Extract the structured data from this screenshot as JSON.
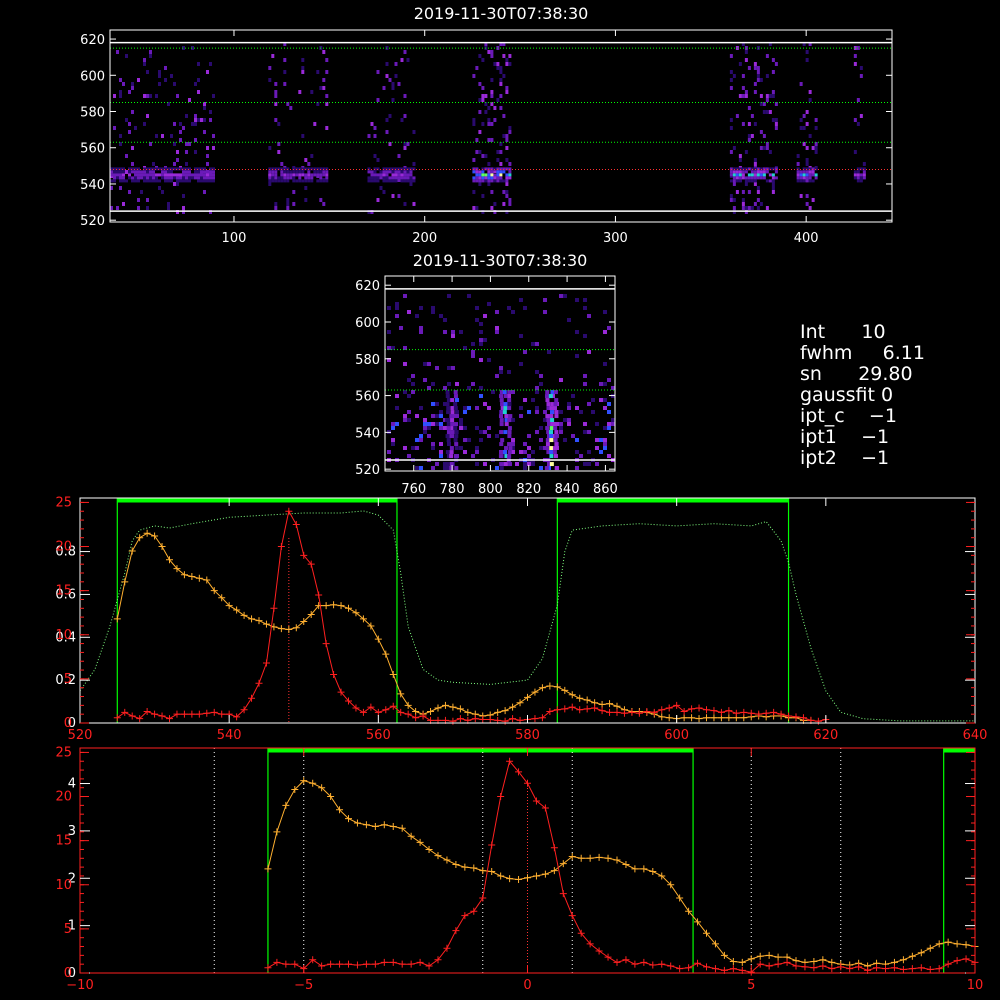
{
  "colors": {
    "background": "#000000",
    "white": "#ffffff",
    "red": "#ff2020",
    "orange": "#ffb030",
    "green": "#00ff00",
    "lightgreen": "#80ff80",
    "darkred": "#ff3030"
  },
  "info": [
    {
      "key": "Int",
      "value": "10"
    },
    {
      "key": "fwhm",
      "value": "6.11"
    },
    {
      "key": "sn",
      "value": "29.80"
    },
    {
      "key": "gaussfit",
      "value": "0"
    },
    {
      "key": "ipt_c",
      "value": "−1"
    },
    {
      "key": "ipt1",
      "value": "−1"
    },
    {
      "key": "ipt2",
      "value": "−1"
    }
  ],
  "chart_data": [
    {
      "type": "heatmap",
      "title": "2019-11-30T07:38:30",
      "xlim": [
        35,
        445
      ],
      "ylim": [
        519,
        625
      ],
      "xticks": [
        100,
        200,
        300,
        400
      ],
      "yticks": [
        520,
        540,
        560,
        580,
        600,
        620
      ],
      "white_lines": [
        525,
        618
      ],
      "green_dotted_lines": [
        563,
        585,
        615
      ],
      "red_dotted_lines": [
        548
      ],
      "bright_row": 545,
      "bands": [
        [
          35,
          90,
          0.5
        ],
        [
          118,
          148,
          0.5
        ],
        [
          170,
          195,
          0.5
        ],
        [
          225,
          245,
          1.0
        ],
        [
          360,
          385,
          0.8
        ],
        [
          395,
          405,
          0.7
        ],
        [
          425,
          430,
          0.5
        ]
      ]
    },
    {
      "type": "heatmap",
      "title": "2019-11-30T07:38:30",
      "xlim": [
        745,
        865
      ],
      "ylim": [
        519,
        625
      ],
      "xticks": [
        760,
        780,
        800,
        820,
        840,
        860
      ],
      "yticks": [
        520,
        540,
        560,
        580,
        600,
        620
      ],
      "white_lines": [
        525,
        618
      ],
      "green_dotted_lines": [
        563,
        585
      ],
      "streaks": [
        [
          780,
          0.5
        ],
        [
          808,
          0.8
        ],
        [
          832,
          1.0
        ]
      ]
    },
    {
      "type": "line",
      "xlim": [
        520,
        640
      ],
      "xticks": [
        520,
        540,
        560,
        580,
        600,
        620,
        640
      ],
      "left_ylim": [
        0,
        1.05
      ],
      "left_yticks": [
        0,
        0.2,
        0.4,
        0.6,
        0.8
      ],
      "red_ylim": [
        0,
        25.5
      ],
      "red_yticks": [
        0,
        5,
        10,
        15,
        20,
        25
      ],
      "green_boxes": [
        [
          525,
          562.5
        ],
        [
          584,
          615
        ]
      ],
      "red_dotted_x": [
        548
      ],
      "series": [
        {
          "axis": "left",
          "color": "lightgreen",
          "style": "dotted",
          "x": [
            520,
            522,
            524,
            526,
            527,
            528,
            530,
            532,
            535,
            540,
            545,
            550,
            555,
            558,
            560,
            562,
            563,
            564,
            566,
            568,
            570,
            575,
            580,
            582,
            584,
            585,
            586,
            590,
            595,
            600,
            605,
            610,
            612,
            614,
            615,
            616,
            618,
            620,
            622,
            625,
            630,
            635,
            640
          ],
          "y": [
            0.15,
            0.25,
            0.45,
            0.7,
            0.85,
            0.9,
            0.92,
            0.91,
            0.93,
            0.96,
            0.97,
            0.98,
            0.98,
            0.99,
            0.97,
            0.9,
            0.7,
            0.45,
            0.25,
            0.2,
            0.19,
            0.18,
            0.2,
            0.3,
            0.55,
            0.8,
            0.9,
            0.92,
            0.93,
            0.92,
            0.93,
            0.92,
            0.94,
            0.85,
            0.75,
            0.6,
            0.35,
            0.15,
            0.05,
            0.02,
            0.01,
            0.01,
            0.01
          ]
        },
        {
          "axis": "red",
          "color": "orange",
          "style": "solid",
          "x": [
            525,
            526,
            527,
            528,
            529,
            530,
            531,
            532,
            533,
            534,
            535,
            536,
            537,
            538,
            539,
            540,
            541,
            542,
            543,
            544,
            545,
            546,
            547,
            548,
            549,
            550,
            551,
            552,
            553,
            554,
            555,
            556,
            557,
            558,
            559,
            560,
            561,
            562,
            563,
            564,
            565,
            566,
            567,
            568,
            569,
            570,
            571,
            572,
            573,
            574,
            575,
            576,
            577,
            578,
            579,
            580,
            581,
            582,
            583,
            584,
            585,
            586,
            587,
            588,
            589,
            590,
            591,
            592,
            593,
            594,
            595,
            596,
            597,
            598,
            599,
            600,
            601,
            602,
            603,
            604,
            605,
            606,
            607,
            608,
            609,
            610,
            611,
            612,
            613,
            614,
            615,
            616,
            617,
            618
          ],
          "y": [
            11.8,
            16,
            19.5,
            21,
            21.5,
            21.2,
            20,
            18.5,
            17.5,
            16.8,
            16.6,
            16.4,
            16.2,
            15,
            14.2,
            13.3,
            12.8,
            12.2,
            11.8,
            11.6,
            11.2,
            10.9,
            10.7,
            10.6,
            10.8,
            11.5,
            12.3,
            13.3,
            13.3,
            13.4,
            13.3,
            13,
            12.5,
            11.8,
            11,
            9.5,
            7.8,
            5.5,
            3.3,
            2,
            1.3,
            1,
            1.3,
            1.7,
            2,
            1.8,
            1.6,
            1.2,
            1,
            0.8,
            0.9,
            1.2,
            1.4,
            1.8,
            2.3,
            2.9,
            3.5,
            4,
            4.2,
            4.1,
            3.7,
            3.2,
            2.8,
            2.6,
            2.3,
            2.1,
            2.2,
            1.9,
            1.5,
            1.3,
            1.3,
            1.2,
            1,
            0.7,
            0.6,
            0.5,
            0.6,
            0.6,
            0.5,
            0.6,
            0.6,
            0.6,
            0.6,
            0.6,
            0.6,
            0.7,
            0.8,
            0.7,
            0.8,
            0.8,
            0.6,
            0.6,
            0.3,
            0.3
          ]
        },
        {
          "axis": "red",
          "color": "red",
          "style": "solid",
          "x": [
            525,
            526,
            527,
            528,
            529,
            530,
            531,
            532,
            533,
            534,
            535,
            536,
            537,
            538,
            539,
            540,
            541,
            542,
            543,
            544,
            545,
            546,
            547,
            548,
            549,
            550,
            551,
            552,
            553,
            554,
            555,
            556,
            557,
            558,
            559,
            560,
            561,
            562,
            563,
            564,
            565,
            566,
            567,
            568,
            569,
            570,
            571,
            572,
            573,
            574,
            575,
            576,
            577,
            578,
            579,
            580,
            581,
            582,
            583,
            584,
            585,
            586,
            587,
            588,
            589,
            590,
            591,
            592,
            593,
            594,
            595,
            596,
            597,
            598,
            599,
            600,
            601,
            602,
            603,
            604,
            605,
            606,
            607,
            608,
            609,
            610,
            611,
            612,
            613,
            614,
            615,
            616,
            617,
            618,
            619,
            620
          ],
          "y": [
            0.6,
            1.2,
            0.8,
            0.5,
            1.3,
            1,
            0.8,
            0.5,
            1,
            1,
            1,
            1,
            1.1,
            1.2,
            1,
            1,
            0.7,
            1.5,
            2.8,
            4.5,
            6.8,
            13,
            20,
            24,
            22.5,
            19,
            18,
            14.5,
            9,
            5.5,
            3.5,
            2.5,
            1.7,
            1.2,
            1.8,
            1.2,
            1.5,
            1.9,
            1.2,
            1,
            0.6,
            0.8,
            0.3,
            0.3,
            0.3,
            0.2,
            0.5,
            0.3,
            0.5,
            0.4,
            0.4,
            0.3,
            0.2,
            0.5,
            0.3,
            0.4,
            0.5,
            0.6,
            1.3,
            1.5,
            1.6,
            1.8,
            1.5,
            1.6,
            1.7,
            1.4,
            1.2,
            1.2,
            1.1,
            1.2,
            1.1,
            1.3,
            1.2,
            1.5,
            1.7,
            2,
            1.3,
            1.6,
            1.7,
            1.5,
            1.4,
            1.2,
            1.4,
            1.1,
            1.2,
            1.1,
            1,
            1.1,
            1.2,
            1,
            0.8,
            0.7,
            0.6,
            0.3,
            0.2,
            0.4
          ]
        }
      ]
    },
    {
      "type": "line",
      "xlim": [
        -10,
        10
      ],
      "xticks": [
        -10,
        -5,
        0,
        5,
        10
      ],
      "left_ylim": [
        0,
        4.75
      ],
      "left_yticks": [
        0,
        1,
        2,
        3,
        4
      ],
      "red_ylim": [
        0,
        25.5
      ],
      "red_yticks": [
        0,
        5,
        10,
        15,
        20,
        25
      ],
      "green_boxes": [
        [
          -5.8,
          3.7
        ],
        [
          9.3,
          10.5
        ]
      ],
      "white_dotted_x": [
        -7,
        -5,
        -1,
        1,
        5,
        7
      ],
      "red_dotted_x": [
        0
      ],
      "series": [
        {
          "axis": "red",
          "color": "orange",
          "style": "solid",
          "x": [
            -5.8,
            -5.6,
            -5.4,
            -5.2,
            -5,
            -4.8,
            -4.6,
            -4.4,
            -4.2,
            -4,
            -3.8,
            -3.6,
            -3.4,
            -3.2,
            -3,
            -2.8,
            -2.6,
            -2.4,
            -2.2,
            -2,
            -1.8,
            -1.6,
            -1.4,
            -1.2,
            -1,
            -0.8,
            -0.6,
            -0.4,
            -0.2,
            0,
            0.2,
            0.4,
            0.6,
            0.8,
            1,
            1.2,
            1.4,
            1.6,
            1.8,
            2,
            2.2,
            2.4,
            2.6,
            2.8,
            3,
            3.2,
            3.4,
            3.6,
            3.8,
            4,
            4.2,
            4.4,
            4.6,
            4.8,
            5,
            5.2,
            5.4,
            5.6,
            5.8,
            6,
            6.2,
            6.4,
            6.6,
            6.8,
            7,
            7.2,
            7.4,
            7.6,
            7.8,
            8,
            8.2,
            8.4,
            8.6,
            8.8,
            9,
            9.2,
            9.4,
            9.6,
            9.8,
            10
          ],
          "y": [
            11.8,
            16,
            19,
            20.8,
            21.8,
            21.5,
            21,
            20,
            18.5,
            17.5,
            17,
            16.8,
            16.6,
            16.8,
            16.6,
            16.4,
            15.5,
            14.8,
            14,
            13.3,
            12.8,
            12.3,
            12,
            11.9,
            11.6,
            11.5,
            11,
            10.7,
            10.6,
            10.8,
            11,
            11.2,
            11.6,
            12.4,
            13.2,
            13,
            13,
            13.1,
            13,
            12.8,
            12.3,
            11.8,
            11.8,
            11.5,
            11,
            10,
            8.5,
            7,
            5.8,
            4.5,
            3.3,
            2,
            1.3,
            1.2,
            1.6,
            1.9,
            2,
            1.8,
            1.8,
            1.4,
            1.2,
            1.3,
            1.5,
            1.2,
            1,
            0.9,
            1.1,
            0.8,
            1.1,
            1,
            1.2,
            1.5,
            1.9,
            2.3,
            2.8,
            3.3,
            3.5,
            3.3,
            3.2,
            3
          ]
        },
        {
          "axis": "red",
          "color": "red",
          "style": "solid",
          "x": [
            -5.8,
            -5.6,
            -5.4,
            -5.2,
            -5,
            -4.8,
            -4.6,
            -4.4,
            -4.2,
            -4,
            -3.8,
            -3.6,
            -3.4,
            -3.2,
            -3,
            -2.8,
            -2.6,
            -2.4,
            -2.2,
            -2,
            -1.8,
            -1.6,
            -1.4,
            -1.2,
            -1,
            -0.8,
            -0.6,
            -0.4,
            -0.2,
            0,
            0.2,
            0.4,
            0.6,
            0.8,
            1,
            1.2,
            1.4,
            1.6,
            1.8,
            2,
            2.2,
            2.4,
            2.6,
            2.8,
            3,
            3.2,
            3.4,
            3.6,
            3.8,
            4,
            4.2,
            4.4,
            4.6,
            4.8,
            5,
            5.2,
            5.4,
            5.6,
            5.8,
            6,
            6.2,
            6.4,
            6.6,
            6.8,
            7,
            7.2,
            7.4,
            7.6,
            7.8,
            8,
            8.2,
            8.4,
            8.6,
            8.8,
            9,
            9.2,
            9.4,
            9.6,
            9.8,
            10
          ],
          "y": [
            0.6,
            1.2,
            1,
            1,
            0.5,
            1.5,
            0.8,
            1,
            1,
            1,
            0.9,
            1,
            1,
            1.2,
            1.2,
            1,
            1,
            1.2,
            0.8,
            1.5,
            2.8,
            4.8,
            6.5,
            7,
            8.5,
            14.5,
            20,
            24,
            22.8,
            21.5,
            19.5,
            18.7,
            14.2,
            9,
            6.5,
            4.5,
            3.3,
            2.5,
            1.8,
            1.2,
            1.5,
            1,
            1.2,
            0.9,
            1,
            0.8,
            0.5,
            0.6,
            1.1,
            0.7,
            0.5,
            0.3,
            0.5,
            0.3,
            0.1,
            1,
            0.8,
            1,
            1.2,
            0.8,
            0.7,
            0.6,
            0.8,
            0.5,
            0.7,
            0.5,
            0.7,
            0.3,
            0.6,
            0.5,
            0.6,
            0.4,
            0.5,
            0.6,
            0.4,
            0.5,
            1,
            1.4,
            1.6,
            1.2
          ]
        }
      ]
    }
  ]
}
